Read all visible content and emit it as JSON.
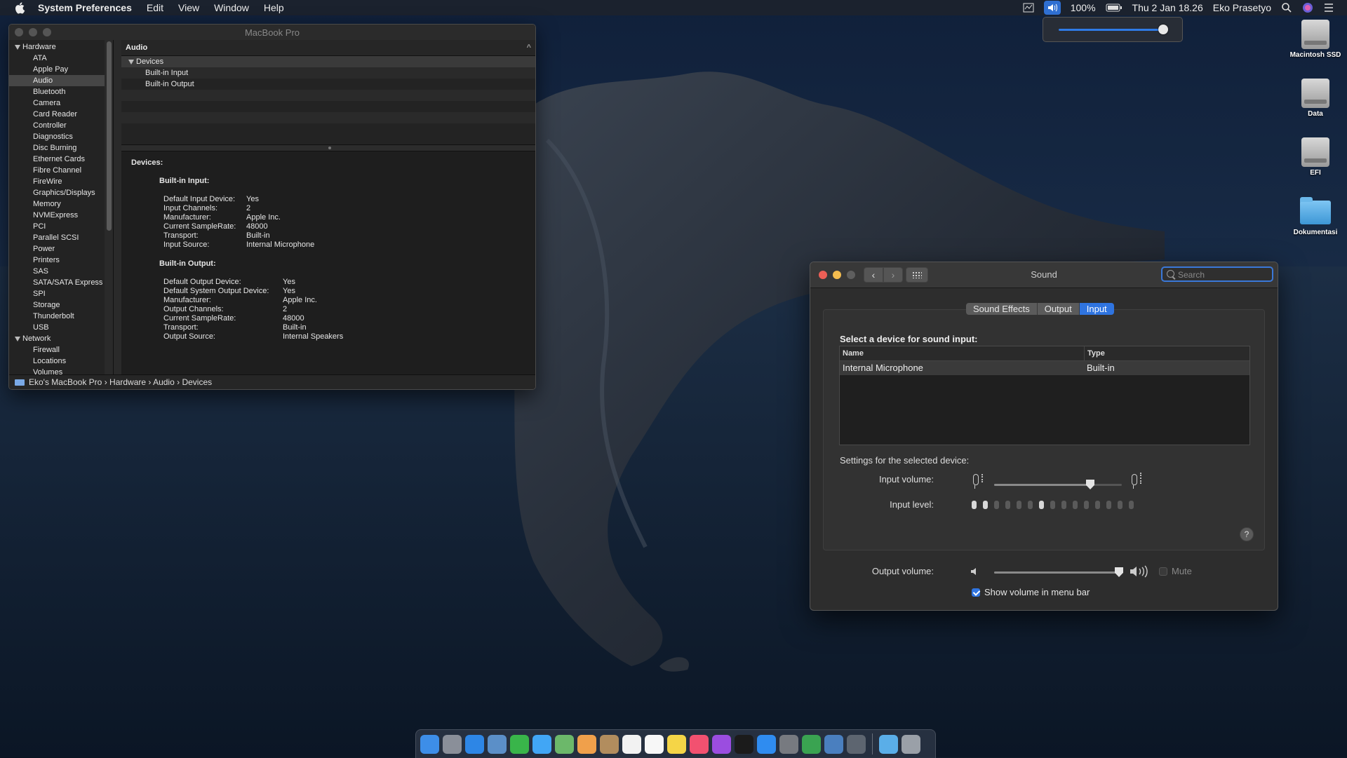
{
  "menubar": {
    "app_name": "System Preferences",
    "menus": [
      "Edit",
      "View",
      "Window",
      "Help"
    ],
    "battery": "100%",
    "datetime": "Thu 2 Jan  18.26",
    "user": "Eko Prasetyo"
  },
  "volume_popup": {
    "level": 0.95
  },
  "desktop_icons": [
    {
      "label": "Macintosh SSD",
      "kind": "disk"
    },
    {
      "label": "Data",
      "kind": "disk"
    },
    {
      "label": "EFI",
      "kind": "disk"
    },
    {
      "label": "Dokumentasi",
      "kind": "folder"
    }
  ],
  "sysinfo": {
    "title": "MacBook Pro",
    "sidebar": [
      {
        "label": "Hardware",
        "group": true
      },
      {
        "label": "ATA"
      },
      {
        "label": "Apple Pay"
      },
      {
        "label": "Audio",
        "selected": true
      },
      {
        "label": "Bluetooth"
      },
      {
        "label": "Camera"
      },
      {
        "label": "Card Reader"
      },
      {
        "label": "Controller"
      },
      {
        "label": "Diagnostics"
      },
      {
        "label": "Disc Burning"
      },
      {
        "label": "Ethernet Cards"
      },
      {
        "label": "Fibre Channel"
      },
      {
        "label": "FireWire"
      },
      {
        "label": "Graphics/Displays"
      },
      {
        "label": "Memory"
      },
      {
        "label": "NVMExpress"
      },
      {
        "label": "PCI"
      },
      {
        "label": "Parallel SCSI"
      },
      {
        "label": "Power"
      },
      {
        "label": "Printers"
      },
      {
        "label": "SAS"
      },
      {
        "label": "SATA/SATA Express"
      },
      {
        "label": "SPI"
      },
      {
        "label": "Storage"
      },
      {
        "label": "Thunderbolt"
      },
      {
        "label": "USB"
      },
      {
        "label": "Network",
        "group": true
      },
      {
        "label": "Firewall"
      },
      {
        "label": "Locations"
      },
      {
        "label": "Volumes"
      }
    ],
    "header": "Audio",
    "tree": {
      "group": "Devices",
      "items": [
        "Built-in Input",
        "Built-in Output"
      ]
    },
    "detail": {
      "heading": "Devices:",
      "input_title": "Built-in Input:",
      "input": [
        {
          "k": "Default Input Device:",
          "v": "Yes"
        },
        {
          "k": "Input Channels:",
          "v": "2"
        },
        {
          "k": "Manufacturer:",
          "v": "Apple Inc."
        },
        {
          "k": "Current SampleRate:",
          "v": "48000"
        },
        {
          "k": "Transport:",
          "v": "Built-in"
        },
        {
          "k": "Input Source:",
          "v": "Internal Microphone"
        }
      ],
      "output_title": "Built-in Output:",
      "output": [
        {
          "k": "Default Output Device:",
          "v": "Yes"
        },
        {
          "k": "Default System Output Device:",
          "v": "Yes"
        },
        {
          "k": "Manufacturer:",
          "v": "Apple Inc."
        },
        {
          "k": "Output Channels:",
          "v": "2"
        },
        {
          "k": "Current SampleRate:",
          "v": "48000"
        },
        {
          "k": "Transport:",
          "v": "Built-in"
        },
        {
          "k": "Output Source:",
          "v": "Internal Speakers"
        }
      ]
    },
    "breadcrumb": [
      "Eko's MacBook Pro",
      "Hardware",
      "Audio",
      "Devices"
    ]
  },
  "sound": {
    "title": "Sound",
    "search_placeholder": "Search",
    "tabs": [
      {
        "label": "Sound Effects"
      },
      {
        "label": "Output"
      },
      {
        "label": "Input",
        "active": true
      }
    ],
    "select_label": "Select a device for sound input:",
    "table": {
      "headers": [
        "Name",
        "Type"
      ],
      "rows": [
        {
          "name": "Internal Microphone",
          "type": "Built-in"
        }
      ]
    },
    "settings_label": "Settings for the selected device:",
    "input_volume_label": "Input volume:",
    "input_volume": 0.75,
    "input_level_label": "Input level:",
    "input_level_active": 7,
    "input_level_total": 15,
    "help": "?",
    "output_volume_label": "Output volume:",
    "output_volume": 0.97,
    "mute_label": "Mute",
    "mute": false,
    "show_volume_label": "Show volume in menu bar",
    "show_volume": true
  },
  "dock": {
    "apps": [
      {
        "icon": "finder-icon",
        "color": "#3d8ee8"
      },
      {
        "icon": "launchpad-icon",
        "color": "#8a8f99"
      },
      {
        "icon": "safari-icon",
        "color": "#2d86e6"
      },
      {
        "icon": "preview-icon",
        "color": "#5b8fc8"
      },
      {
        "icon": "facetime-icon",
        "color": "#39b54a"
      },
      {
        "icon": "messages-icon",
        "color": "#41a6f5"
      },
      {
        "icon": "maps-icon",
        "color": "#6cb86a"
      },
      {
        "icon": "photos-icon",
        "color": "#f0a04b"
      },
      {
        "icon": "contacts-icon",
        "color": "#b28d5e"
      },
      {
        "icon": "calendar-icon",
        "color": "#f2f2f2"
      },
      {
        "icon": "reminders-icon",
        "color": "#f7f7f7"
      },
      {
        "icon": "notes-icon",
        "color": "#f5d547"
      },
      {
        "icon": "music-icon",
        "color": "#f25170"
      },
      {
        "icon": "podcasts-icon",
        "color": "#9b4de0"
      },
      {
        "icon": "tv-icon",
        "color": "#1b1b1b"
      },
      {
        "icon": "appstore-icon",
        "color": "#2f8cf0"
      },
      {
        "icon": "systemprefs-icon",
        "color": "#777a80"
      },
      {
        "icon": "globe-icon",
        "color": "#3aa351"
      },
      {
        "icon": "network-utility-icon",
        "color": "#4a7fbf"
      },
      {
        "icon": "tool-icon",
        "color": "#5d6570"
      }
    ],
    "extras": [
      {
        "icon": "downloads-folder-icon",
        "color": "#5aaee8"
      },
      {
        "icon": "trash-icon",
        "color": "#9aa0a8"
      }
    ]
  }
}
